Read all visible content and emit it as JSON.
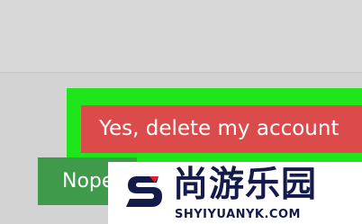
{
  "dialog": {
    "confirm_label": "Yes, delete my account",
    "cancel_label": "Nope"
  },
  "watermark": {
    "brand_name_cn": "尚游乐园",
    "url": "SHYIYUANYK.COM",
    "logo_icon": "s-logo-icon"
  },
  "colors": {
    "highlight_box": "#1ee61a",
    "confirm_button": "#db4b4b",
    "cancel_button": "#3f9a4c",
    "watermark_text": "#141a4a",
    "watermark_accent": "#e61e2b"
  }
}
